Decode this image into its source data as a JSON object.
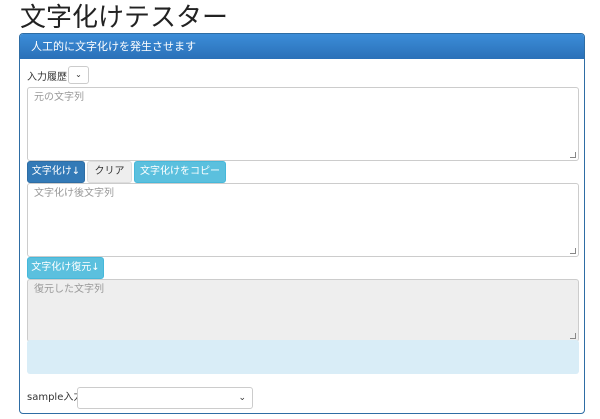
{
  "page": {
    "title": "文字化けテスター"
  },
  "panel": {
    "heading": "人工的に文字化けを発生させます"
  },
  "history": {
    "label": "入力履歴",
    "selected": ""
  },
  "source_text": {
    "placeholder": "元の文字列",
    "value": ""
  },
  "buttons": {
    "garble": "文字化け↓",
    "clear": "クリア",
    "copy": "文字化けをコピー",
    "restore": "文字化け復元↓"
  },
  "garbled_text": {
    "placeholder": "文字化け後文字列",
    "value": ""
  },
  "restored_text": {
    "placeholder": "復元した文字列",
    "value": ""
  },
  "sample": {
    "label": "sample入力",
    "selected": ""
  },
  "icons": {
    "dropdown": "chevron-down-icon",
    "resize": "resize-grip-icon"
  },
  "colors": {
    "primary": "#337ab7",
    "info": "#5bc0de",
    "info_bg": "#d9edf7",
    "readonly_bg": "#eeeeee"
  }
}
